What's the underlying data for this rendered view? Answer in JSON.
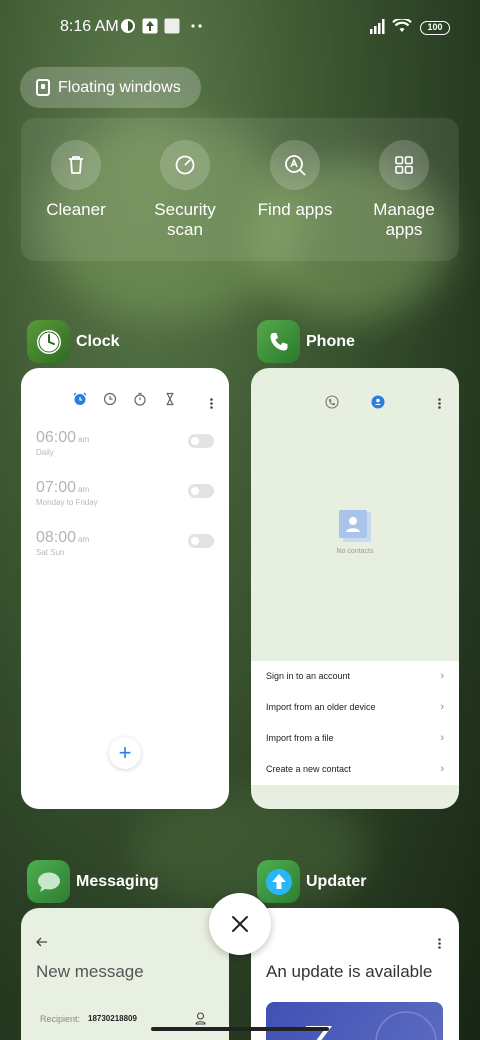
{
  "status_bar": {
    "time": "8:16 AM",
    "battery": "100"
  },
  "floating_windows": {
    "label": "Floating windows"
  },
  "quick_actions": [
    {
      "label": "Cleaner",
      "icon": "trash-icon"
    },
    {
      "label": "Security scan",
      "icon": "security-scan-icon"
    },
    {
      "label": "Find apps",
      "icon": "find-apps-icon"
    },
    {
      "label": "Manage apps",
      "icon": "grid-icon"
    }
  ],
  "recent_apps": {
    "clock": {
      "name": "Clock",
      "alarms": [
        {
          "time": "06:00",
          "ampm": "am",
          "repeat": "Daily"
        },
        {
          "time": "07:00",
          "ampm": "am",
          "repeat": "Monday to Friday"
        },
        {
          "time": "08:00",
          "ampm": "am",
          "repeat": "Sat Sun"
        }
      ],
      "add_label": "+"
    },
    "phone": {
      "name": "Phone",
      "empty_label": "No contacts",
      "actions": [
        "Sign in to an account",
        "Import from an older device",
        "Import from a file",
        "Create a new contact"
      ]
    },
    "messaging": {
      "name": "Messaging",
      "title": "New message",
      "recipient_label": "Recipient:",
      "recipient_value": "18730218809"
    },
    "updater": {
      "name": "Updater",
      "title": "An update is available"
    }
  },
  "colors": {
    "accent": "#2c7de0",
    "phone_green": "#43a047",
    "updater_blue": "#1e88e5"
  }
}
